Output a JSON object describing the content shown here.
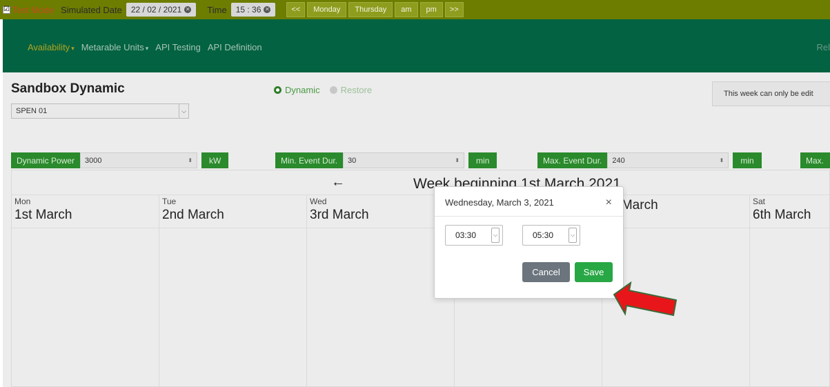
{
  "testbar": {
    "test_mode_label": "Test Mode",
    "simulated_date_label": "Simulated Date",
    "simulated_date_value": "22 / 02 / 2021",
    "time_label": "Time",
    "time_value": "15 : 36",
    "buttons": [
      "<<",
      "Monday",
      "Thursday",
      "am",
      "pm",
      ">>"
    ]
  },
  "nav": {
    "items": [
      {
        "label": "Availability",
        "dropdown": true,
        "active": true
      },
      {
        "label": "Metarable Units",
        "dropdown": true,
        "active": false
      },
      {
        "label": "API Testing",
        "dropdown": false,
        "active": false
      },
      {
        "label": "API Definition",
        "dropdown": false,
        "active": false
      }
    ],
    "right_text": "Rel"
  },
  "page": {
    "title": "Sandbox Dynamic",
    "unit_select_value": "SPEN 01",
    "radio_dynamic": "Dynamic",
    "radio_restore": "Restore",
    "notice": "This week can only be edit"
  },
  "params": {
    "dynamic_power_label": "Dynamic Power",
    "dynamic_power_value": "3000",
    "dynamic_power_unit": "kW",
    "min_event_label": "Min. Event Dur.",
    "min_event_value": "30",
    "min_event_unit": "min",
    "max_event_label": "Max. Event Dur.",
    "max_event_value": "240",
    "max_event_unit": "min",
    "max_trunc_label": "Max."
  },
  "calendar": {
    "back_arrow": "←",
    "week_title": "Week beginning 1st March 2021",
    "days": [
      {
        "name": "Mon",
        "date": "1st March"
      },
      {
        "name": "Tue",
        "date": "2nd March"
      },
      {
        "name": "Wed",
        "date": "3rd March"
      },
      {
        "name": "",
        "date": ""
      },
      {
        "name": "",
        "date": "h March"
      },
      {
        "name": "Sat",
        "date": "6th March"
      }
    ]
  },
  "modal": {
    "title": "Wednesday, March 3, 2021",
    "close": "×",
    "start_time": "03:30",
    "end_time": "05:30",
    "cancel_label": "Cancel",
    "save_label": "Save"
  },
  "colors": {
    "testbar_bg": "#6d7d00",
    "nav_bg": "#026241",
    "accent_green": "#2a8a2c",
    "save_green": "#28a745",
    "cancel_gray": "#6c757d",
    "arrow_red": "#e8161a"
  },
  "icons": {
    "test_mode_check": "checkbox-checked-icon",
    "clear_value": "circle-x-icon",
    "back": "arrow-left-icon",
    "close": "close-icon",
    "annotation": "red-arrow-icon"
  }
}
